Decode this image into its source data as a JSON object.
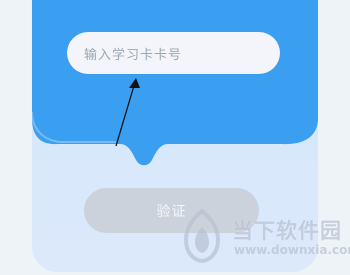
{
  "form": {
    "card_number_placeholder": "输入学习卡卡号",
    "verify_button_label": "验证"
  },
  "watermark": {
    "brand_text": "当下软件园",
    "url_text": "www.downxia.com"
  },
  "colors": {
    "page_bg": "#eef3f8",
    "card_bg": "#d2e4fa",
    "card_header_blue": "#2f9bf0",
    "input_bg": "#f4f5fb",
    "placeholder_text": "#9aa6b3",
    "button_bg": "#cbd2dc",
    "button_text": "#f6f7f9",
    "watermark_text": "#b8c2d1"
  },
  "icons": {
    "annotation_arrow": "arrow-up-right",
    "watermark_logo": "downxia-logo"
  }
}
